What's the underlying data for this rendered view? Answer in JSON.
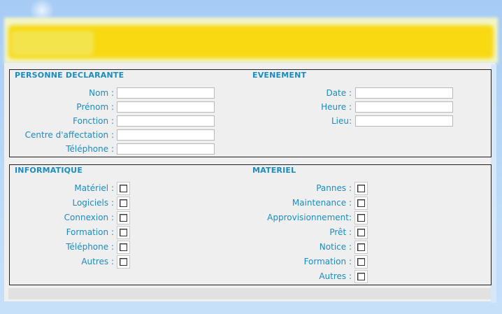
{
  "declarant": {
    "title": "PERSONNE DECLARANTE",
    "fields": [
      {
        "label": "Nom :",
        "value": ""
      },
      {
        "label": "Prénom :",
        "value": ""
      },
      {
        "label": "Fonction :",
        "value": ""
      },
      {
        "label": "Centre d'affectation :",
        "value": ""
      },
      {
        "label": "Téléphone :",
        "value": ""
      }
    ]
  },
  "evenement": {
    "title": "EVENEMENT",
    "fields": [
      {
        "label": "Date :",
        "value": ""
      },
      {
        "label": "Heure :",
        "value": ""
      },
      {
        "label": "Lieu:",
        "value": ""
      }
    ]
  },
  "informatique": {
    "title": "INFORMATIQUE",
    "items": [
      {
        "label": "Matériel :",
        "checked": false
      },
      {
        "label": "Logiciels :",
        "checked": false
      },
      {
        "label": "Connexion :",
        "checked": false
      },
      {
        "label": "Formation :",
        "checked": false
      },
      {
        "label": "Téléphone :",
        "checked": false
      },
      {
        "label": "Autres :",
        "checked": false
      }
    ]
  },
  "materiel": {
    "title": "MATERIEL",
    "items": [
      {
        "label": "Pannes :",
        "checked": false
      },
      {
        "label": "Maintenance :",
        "checked": false
      },
      {
        "label": "Approvisionnement:",
        "checked": false
      },
      {
        "label": "Prêt :",
        "checked": false
      },
      {
        "label": "Notice :",
        "checked": false
      },
      {
        "label": "Formation :",
        "checked": false
      },
      {
        "label": "Autres :",
        "checked": false
      }
    ]
  },
  "colors": {
    "label": "#1a8cc0",
    "header_bar": "#f8d912",
    "page_background": "#a8cdf6",
    "panel": "#efefef"
  }
}
